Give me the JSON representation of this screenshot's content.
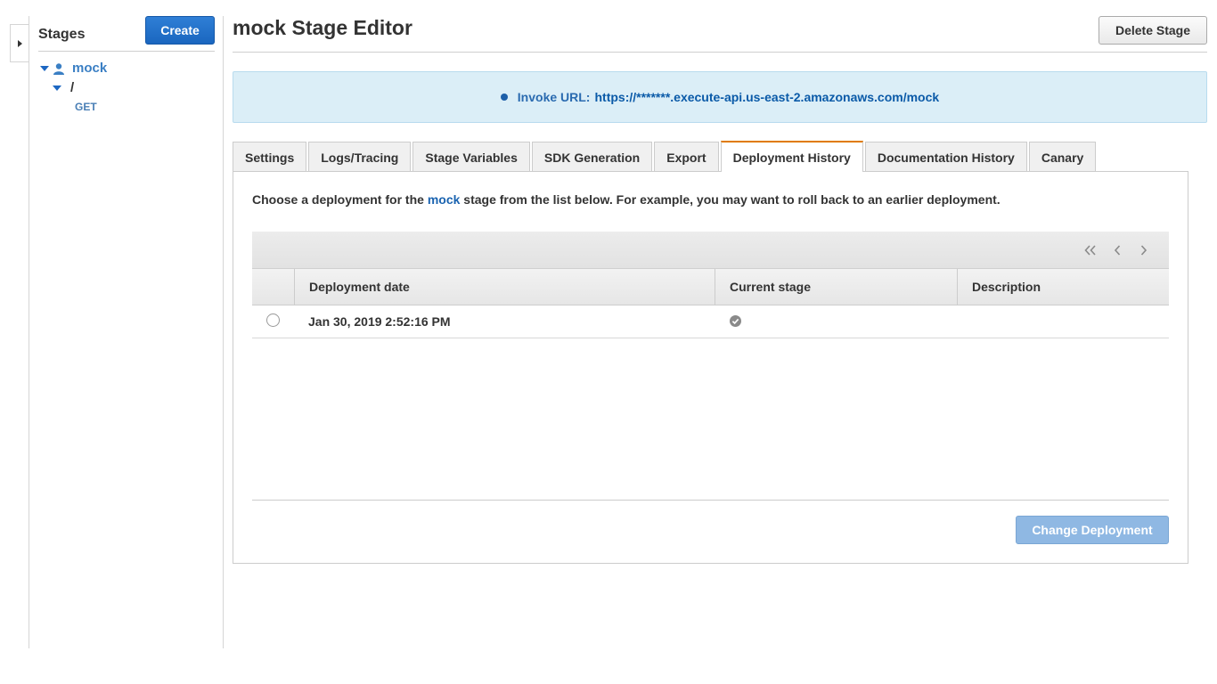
{
  "sidebar": {
    "title": "Stages",
    "create_label": "Create",
    "tree": {
      "stage_name": "mock",
      "resource_path": "/",
      "method": "GET"
    }
  },
  "header": {
    "title": "mock Stage Editor",
    "delete_label": "Delete Stage"
  },
  "invoke": {
    "label": "Invoke URL:",
    "url": "https://*******.execute-api.us-east-2.amazonaws.com/mock"
  },
  "tabs": [
    {
      "label": "Settings"
    },
    {
      "label": "Logs/Tracing"
    },
    {
      "label": "Stage Variables"
    },
    {
      "label": "SDK Generation"
    },
    {
      "label": "Export"
    },
    {
      "label": "Deployment History",
      "active": true
    },
    {
      "label": "Documentation History"
    },
    {
      "label": "Canary"
    }
  ],
  "panel": {
    "intro_prefix": "Choose a deployment for the ",
    "intro_stage": "mock",
    "intro_suffix": " stage from the list below. For example, you may want to roll back to an earlier deployment."
  },
  "table": {
    "columns": {
      "date": "Deployment date",
      "current": "Current stage",
      "description": "Description"
    },
    "rows": [
      {
        "date": "Jan 30, 2019 2:52:16 PM",
        "current": true,
        "description": ""
      }
    ]
  },
  "actions": {
    "change_label": "Change Deployment"
  },
  "colors": {
    "accent": "#1a66bf",
    "active_tab": "#e07b00",
    "banner_bg": "#dbeef7"
  }
}
